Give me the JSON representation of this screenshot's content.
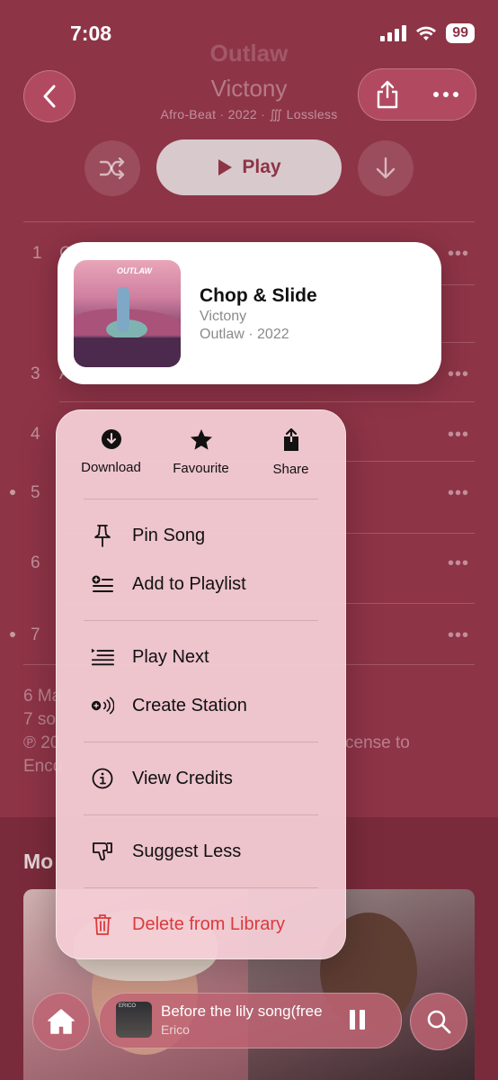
{
  "status_bar": {
    "time": "7:08",
    "battery": "99",
    "icons": [
      "signal-icon",
      "wifi-icon",
      "battery-icon"
    ]
  },
  "header": {
    "album_title": "Outlaw",
    "artist": "Victony",
    "meta": "Afro-Beat · 2022 · ",
    "lossless_label": "Lossless",
    "play_label": "Play",
    "icons": [
      "chevron-left-icon",
      "share-icon",
      "more-icon",
      "shuffle-icon",
      "play-icon",
      "download-arrow-icon"
    ]
  },
  "tracks": [
    {
      "number": "1",
      "title_fragment": "C",
      "dot": false
    },
    {
      "number": "3",
      "title_fragment": "A",
      "dot": false
    },
    {
      "number": "4",
      "title_fragment": "",
      "dot": false
    },
    {
      "number": "5",
      "title_fragment": "",
      "dot": true
    },
    {
      "number": "6",
      "title_fragment": "",
      "dot": false
    },
    {
      "number": "7",
      "title_fragment": "",
      "dot": true
    }
  ],
  "footer": {
    "line1": "6 Ma",
    "line2": "7 so",
    "line3_left": "℗ 20",
    "line3_right": "cense to",
    "line4": "Enco"
  },
  "more_section": {
    "label": "Mo"
  },
  "song_card": {
    "title": "Chop & Slide",
    "artist": "Victony",
    "album_year": "Outlaw · 2022",
    "art_text": "OUTLAW"
  },
  "menu": {
    "quick_actions": [
      {
        "label": "Download",
        "icon": "download-circle-icon"
      },
      {
        "label": "Favourite",
        "icon": "star-icon"
      },
      {
        "label": "Share",
        "icon": "share-icon"
      }
    ],
    "items": [
      {
        "label": "Pin Song",
        "icon": "pin-icon"
      },
      {
        "label": "Add to Playlist",
        "icon": "add-to-playlist-icon"
      },
      {
        "label": "Play Next",
        "icon": "play-next-icon"
      },
      {
        "label": "Create Station",
        "icon": "station-icon"
      },
      {
        "label": "View Credits",
        "icon": "info-icon"
      },
      {
        "label": "Suggest Less",
        "icon": "thumbs-down-icon"
      },
      {
        "label": "Delete from Library",
        "icon": "trash-icon"
      }
    ]
  },
  "now_playing": {
    "title": "Before the lily song(free",
    "artist": "Erico",
    "art_text": "ERICO"
  },
  "colors": {
    "background": "#8e3447",
    "menu": "#f4cdd6",
    "danger": "#d93b3b",
    "accent_button": "#b14a61"
  }
}
